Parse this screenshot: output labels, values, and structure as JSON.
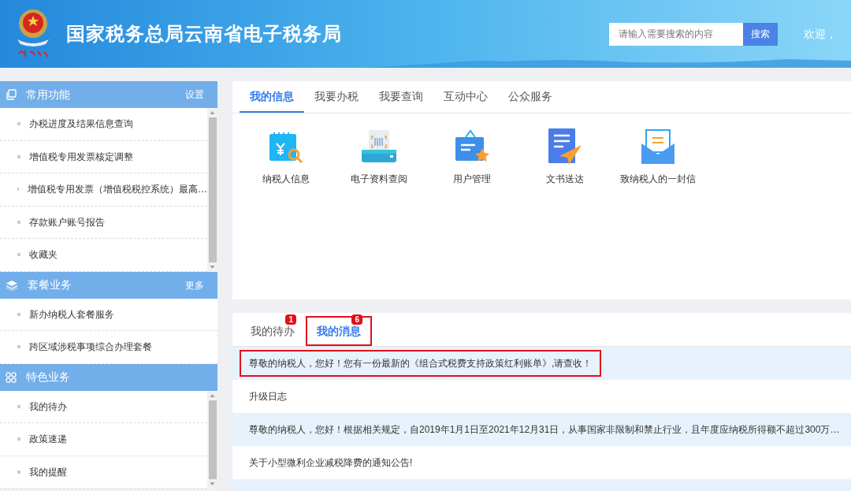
{
  "header": {
    "title": "国家税务总局云南省电子税务局",
    "search": {
      "placeholder": "请输入需要搜索的内容",
      "button": "搜索"
    },
    "greeting": "欢迎，"
  },
  "sidebar": [
    {
      "kind": "copy",
      "title": "常用功能",
      "action": "设置",
      "scroll": true,
      "items": [
        "办税进度及结果信息查询",
        "增值税专用发票核定调整",
        "增值税专用发票（增值税税控系统）最高…",
        "存款账户账号报告",
        "收藏夹"
      ]
    },
    {
      "kind": "layers",
      "title": "套餐业务",
      "action": "更多",
      "scroll": false,
      "items": [
        "新办纳税人套餐服务",
        "跨区域涉税事项综合办理套餐"
      ]
    },
    {
      "kind": "grid",
      "title": "特色业务",
      "scroll": true,
      "items": [
        "我的待办",
        "政策速递",
        "我的提醒"
      ]
    }
  ],
  "top_tabs": [
    {
      "label": "我的信息",
      "selected": true
    },
    {
      "label": "我要办税",
      "selected": false
    },
    {
      "label": "我要查询",
      "selected": false
    },
    {
      "label": "互动中心",
      "selected": false
    },
    {
      "label": "公众服务",
      "selected": false
    }
  ],
  "shortcuts": [
    {
      "kind": "calendar",
      "label": "纳税人信息"
    },
    {
      "kind": "printer",
      "label": "电子资料查阅"
    },
    {
      "kind": "board",
      "label": "用户管理"
    },
    {
      "kind": "document",
      "label": "文书送达"
    },
    {
      "kind": "letter",
      "label": "致纳税人的一封信"
    }
  ],
  "message_tabs": [
    {
      "label": "我的待办",
      "badge": "1",
      "selected": false,
      "outlined": false
    },
    {
      "label": "我的消息",
      "badge": "6",
      "selected": true,
      "outlined": true
    }
  ],
  "messages": [
    {
      "text": "尊敬的纳税人，您好！您有一份最新的《组合式税费支持政策红利账单》,请查收！",
      "outlined": true
    },
    {
      "text": "升级日志",
      "outlined": false
    },
    {
      "text": "尊敬的纳税人，您好！根据相关规定，自2019年1月1日至2021年12月31日，从事国家非限制和禁止行业，且年度应纳税所得额不超过300万…",
      "outlined": false
    },
    {
      "text": "关于小型微利企业减税降费的通知公告!",
      "outlined": false
    }
  ]
}
